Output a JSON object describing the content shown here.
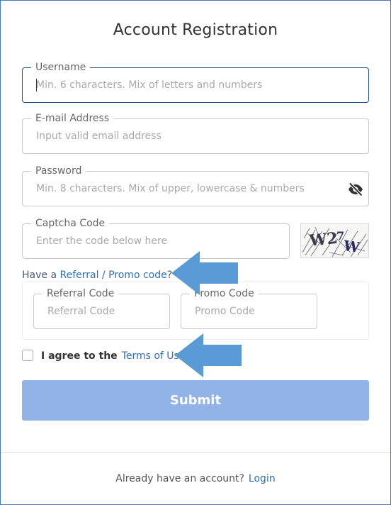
{
  "form": {
    "title": "Account Registration",
    "username": {
      "label": "Username",
      "placeholder": "Min. 6 characters. Mix of letters and numbers"
    },
    "email": {
      "label": "E-mail Address",
      "placeholder": "Input valid email address"
    },
    "password": {
      "label": "Password",
      "placeholder": "Min. 8 characters. Mix of upper, lowercase & numbers",
      "toggle_icon": "eye-off-icon"
    },
    "captcha": {
      "label": "Captcha Code",
      "placeholder": "Enter the code below here",
      "image_text": "W27W"
    },
    "referral_prompt": {
      "prefix": "Have a ",
      "link": "Referral / Promo code",
      "suffix": "?"
    },
    "referral_code": {
      "label": "Referral Code",
      "placeholder": "Referral Code"
    },
    "promo_code": {
      "label": "Promo Code",
      "placeholder": "Promo Code"
    },
    "agree": {
      "text": "I agree to the",
      "link": "Terms of Use",
      "checked": false
    },
    "submit_label": "Submit"
  },
  "footer": {
    "text": "Already have an account?",
    "login_link": "Login"
  },
  "colors": {
    "accent_link": "#2f6fb6",
    "submit_bg": "#91b3e8",
    "focus_border": "#1f4f8f",
    "annotation_arrow": "#5b9bd5",
    "frame_border": "#4a78b8"
  }
}
